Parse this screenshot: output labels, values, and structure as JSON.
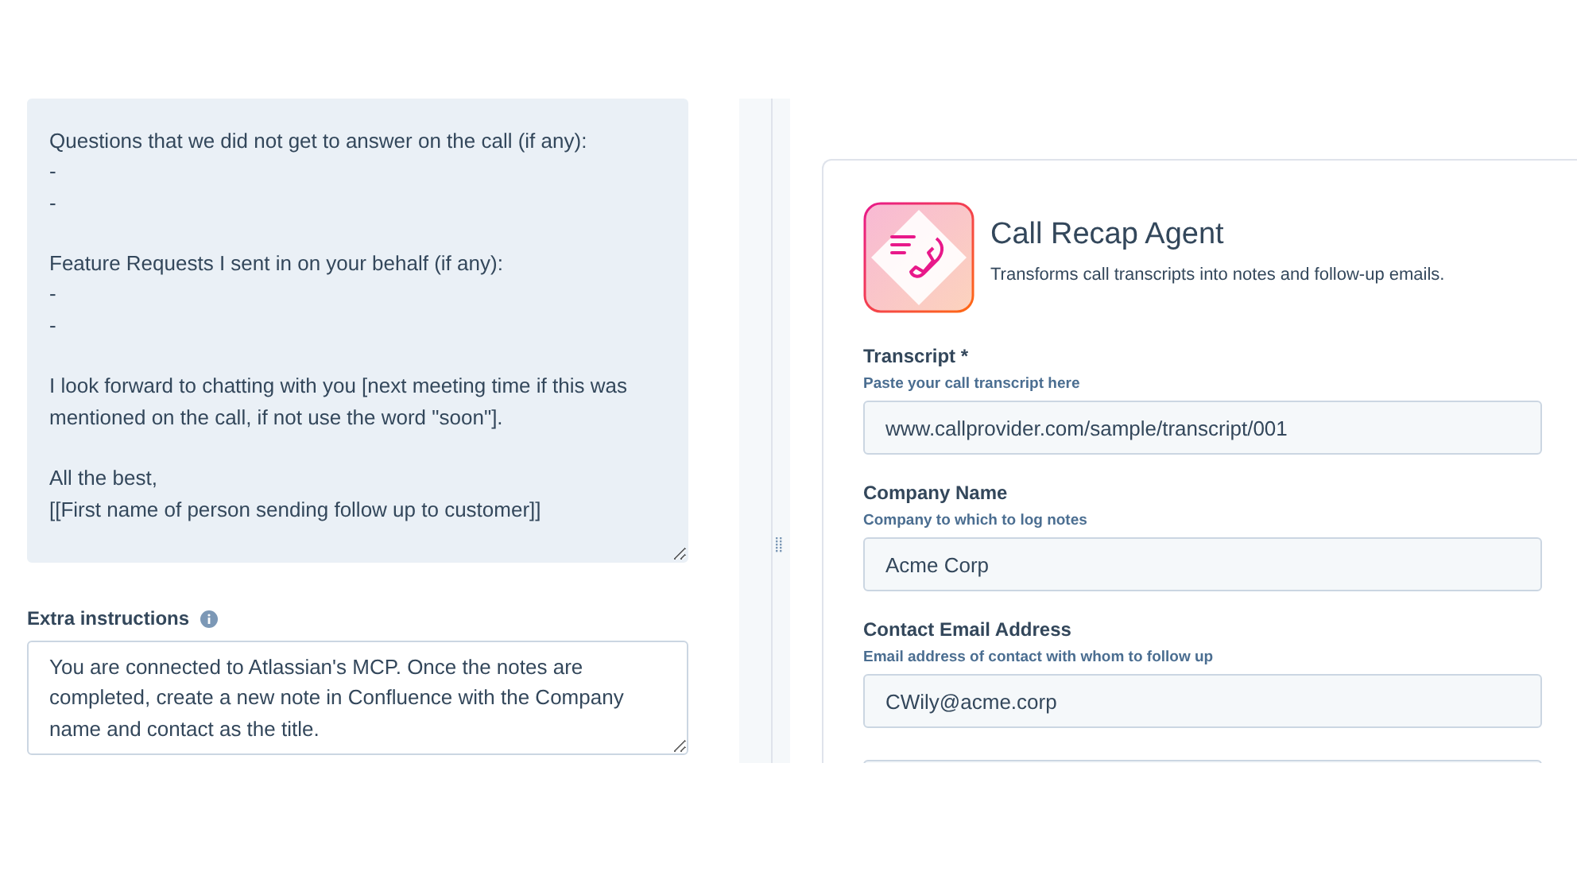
{
  "template_field": {
    "value": "Questions that we did not get to answer on the call (if any):\n-\n-\n\nFeature Requests I sent in on your behalf (if any):\n-\n-\n\nI look forward to chatting with you [next meeting time if this was mentioned on the call, if not use the word \"soon\"].\n\nAll the best,\n[[First name of person sending follow up to customer]]"
  },
  "extra_instructions": {
    "label": "Extra instructions",
    "value": "You are connected to Atlassian's MCP. Once the notes are completed, create a new note in Confluence with the Company name and contact as the title."
  },
  "agent": {
    "title": "Call Recap Agent",
    "description": "Transforms call transcripts into notes and follow-up emails.",
    "fields": [
      {
        "label": "Transcript *",
        "hint": "Paste your call transcript here",
        "value": "www.callprovider.com/sample/transcript/001"
      },
      {
        "label": "Company Name",
        "hint": "Company to which to log notes",
        "value": "Acme Corp"
      },
      {
        "label": "Contact Email Address",
        "hint": "Email address of contact with whom to follow up",
        "value": "CWily@acme.corp"
      }
    ]
  }
}
